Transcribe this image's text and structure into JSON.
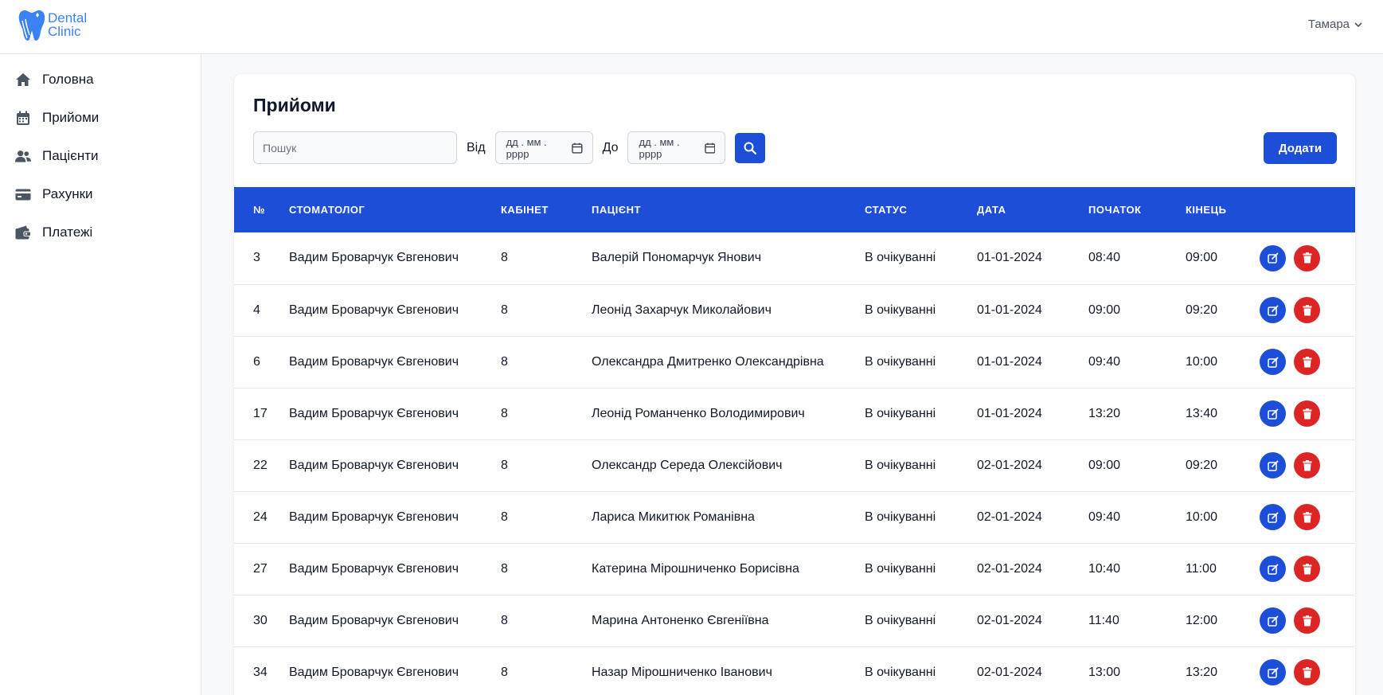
{
  "brand": {
    "line1": "Dental",
    "line2": "Clinic"
  },
  "user": {
    "name": "Тамара"
  },
  "sidebar": {
    "items": [
      {
        "label": "Головна",
        "icon": "home-icon"
      },
      {
        "label": "Прийоми",
        "icon": "calendar-icon"
      },
      {
        "label": "Пацієнти",
        "icon": "users-icon"
      },
      {
        "label": "Рахунки",
        "icon": "credit-card-icon"
      },
      {
        "label": "Платежі",
        "icon": "wallet-icon"
      }
    ]
  },
  "page": {
    "title": "Прийоми"
  },
  "filters": {
    "search_placeholder": "Пошук",
    "from_label": "Від",
    "to_label": "До",
    "date_placeholder": "дд . мм . рррр"
  },
  "add_label": "Додати",
  "colors": {
    "primary": "#1d4ed8",
    "danger": "#dc2626",
    "logo": "#3b82f6"
  },
  "table": {
    "columns": [
      "№",
      "СТОМАТОЛОГ",
      "КАБІНЕТ",
      "ПАЦІЄНТ",
      "СТАТУС",
      "ДАТА",
      "ПОЧАТОК",
      "КІНЕЦЬ"
    ],
    "rows": [
      {
        "id": "3",
        "dentist": "Вадим Броварчук Євгенович",
        "room": "8",
        "patient": "Валерій Пономарчук Янович",
        "status": "В очікуванні",
        "date": "01-01-2024",
        "start": "08:40",
        "end": "09:00"
      },
      {
        "id": "4",
        "dentist": "Вадим Броварчук Євгенович",
        "room": "8",
        "patient": "Леонід Захарчук Миколайович",
        "status": "В очікуванні",
        "date": "01-01-2024",
        "start": "09:00",
        "end": "09:20"
      },
      {
        "id": "6",
        "dentist": "Вадим Броварчук Євгенович",
        "room": "8",
        "patient": "Олександра Дмитренко Олександрівна",
        "status": "В очікуванні",
        "date": "01-01-2024",
        "start": "09:40",
        "end": "10:00"
      },
      {
        "id": "17",
        "dentist": "Вадим Броварчук Євгенович",
        "room": "8",
        "patient": "Леонід Романченко Володимирович",
        "status": "В очікуванні",
        "date": "01-01-2024",
        "start": "13:20",
        "end": "13:40"
      },
      {
        "id": "22",
        "dentist": "Вадим Броварчук Євгенович",
        "room": "8",
        "patient": "Олександр Середа Олексійович",
        "status": "В очікуванні",
        "date": "02-01-2024",
        "start": "09:00",
        "end": "09:20"
      },
      {
        "id": "24",
        "dentist": "Вадим Броварчук Євгенович",
        "room": "8",
        "patient": "Лариса Микитюк Романівна",
        "status": "В очікуванні",
        "date": "02-01-2024",
        "start": "09:40",
        "end": "10:00"
      },
      {
        "id": "27",
        "dentist": "Вадим Броварчук Євгенович",
        "room": "8",
        "patient": "Катерина Мірошниченко Борисівна",
        "status": "В очікуванні",
        "date": "02-01-2024",
        "start": "10:40",
        "end": "11:00"
      },
      {
        "id": "30",
        "dentist": "Вадим Броварчук Євгенович",
        "room": "8",
        "patient": "Марина Антоненко Євгеніївна",
        "status": "В очікуванні",
        "date": "02-01-2024",
        "start": "11:40",
        "end": "12:00"
      },
      {
        "id": "34",
        "dentist": "Вадим Броварчук Євгенович",
        "room": "8",
        "patient": "Назар Мірошниченко Іванович",
        "status": "В очікуванні",
        "date": "02-01-2024",
        "start": "13:00",
        "end": "13:20"
      }
    ]
  }
}
